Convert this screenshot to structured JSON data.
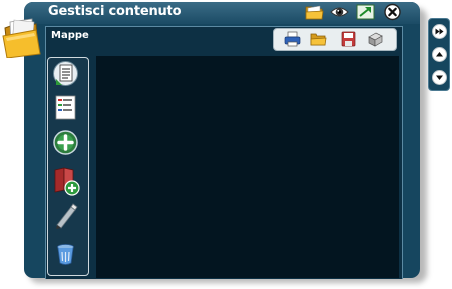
{
  "window": {
    "title": "Gestisci contenuto",
    "title_icons": [
      "folder-icon",
      "eye-icon",
      "fullscreen-icon",
      "close-icon"
    ]
  },
  "section": {
    "title": "Mappe",
    "toolbar_icons": [
      "print-icon",
      "open-folder-icon",
      "save-icon",
      "export-icon"
    ]
  },
  "sidebar": {
    "tools": [
      "document-icon",
      "new-page-icon",
      "add-icon",
      "add-book-icon",
      "pencil-icon",
      "trash-icon"
    ]
  },
  "side_panel": {
    "buttons": [
      "fast-forward-icon",
      "arrow-up-icon",
      "arrow-down-icon"
    ]
  },
  "colors": {
    "panel": "#16465f",
    "content_background": "#031520",
    "title_text": "#ffffff"
  }
}
